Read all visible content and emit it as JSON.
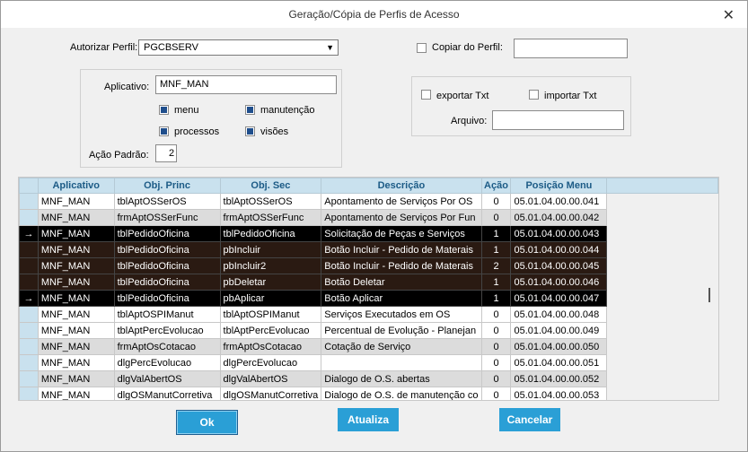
{
  "window": {
    "title": "Geração/Cópia de Perfis de Acesso"
  },
  "form": {
    "autorizar_label": "Autorizar Perfil:",
    "autorizar_value": "PGCBSERV",
    "copiar_label": "Copiar do Perfil:",
    "copiar_value": "",
    "aplicativo_label": "Aplicativo:",
    "aplicativo_value": "MNF_MAN",
    "menu_label": "menu",
    "manutencao_label": "manutenção",
    "processos_label": "processos",
    "visoes_label": "visões",
    "acao_label": "Ação Padrão:",
    "acao_value": "2",
    "exportar_label": "exportar Txt",
    "importar_label": "importar Txt",
    "arquivo_label": "Arquivo:",
    "arquivo_value": ""
  },
  "grid": {
    "columns": [
      "Aplicativo",
      "Obj. Princ",
      "Obj. Sec",
      "Descrição",
      "Ação",
      "Posição Menu"
    ],
    "rows": [
      {
        "style": "norm",
        "arrow": "",
        "cells": [
          "MNF_MAN",
          "tblAptOSSerOS",
          "tblAptOSSerOS",
          "Apontamento de Serviços Por OS",
          "0",
          "05.01.04.00.00.041"
        ]
      },
      {
        "style": "alt",
        "arrow": "",
        "cells": [
          "MNF_MAN",
          "frmAptOSSerFunc",
          "frmAptOSSerFunc",
          "Apontamento de Serviços Por Fun",
          "0",
          "05.01.04.00.00.042"
        ]
      },
      {
        "style": "sel",
        "arrow": "→",
        "cells": [
          "MNF_MAN",
          "tblPedidoOficina",
          "tblPedidoOficina",
          "Solicitação de Peças e Serviços",
          "1",
          "05.01.04.00.00.043"
        ]
      },
      {
        "style": "hl",
        "arrow": "",
        "cells": [
          "MNF_MAN",
          "tblPedidoOficina",
          "pbIncluir",
          "Botão Incluir - Pedido de Materais",
          "1",
          "05.01.04.00.00.044"
        ]
      },
      {
        "style": "hl",
        "arrow": "",
        "cells": [
          "MNF_MAN",
          "tblPedidoOficina",
          "pbIncluir2",
          "Botão Incluir - Pedido de Materais",
          "2",
          "05.01.04.00.00.045"
        ]
      },
      {
        "style": "hl",
        "arrow": "",
        "cells": [
          "MNF_MAN",
          "tblPedidoOficina",
          "pbDeletar",
          "Botão Deletar",
          "1",
          "05.01.04.00.00.046"
        ]
      },
      {
        "style": "sel",
        "arrow": "→",
        "cells": [
          "MNF_MAN",
          "tblPedidoOficina",
          "pbAplicar",
          "Botão Aplicar",
          "1",
          "05.01.04.00.00.047"
        ]
      },
      {
        "style": "norm",
        "arrow": "",
        "cells": [
          "MNF_MAN",
          "tblAptOSPIManut",
          "tblAptOSPIManut",
          "Serviços Executados em OS",
          "0",
          "05.01.04.00.00.048"
        ]
      },
      {
        "style": "norm",
        "arrow": "",
        "cells": [
          "MNF_MAN",
          "tblAptPercEvolucao",
          "tblAptPercEvolucao",
          "Percentual de Evolução - Planejan",
          "0",
          "05.01.04.00.00.049"
        ]
      },
      {
        "style": "alt",
        "arrow": "",
        "cells": [
          "MNF_MAN",
          "frmAptOsCotacao",
          "frmAptOsCotacao",
          "Cotação de Serviço",
          "0",
          "05.01.04.00.00.050"
        ]
      },
      {
        "style": "norm",
        "arrow": "",
        "cells": [
          "MNF_MAN",
          "dlgPercEvolucao",
          "dlgPercEvolucao",
          "",
          "0",
          "05.01.04.00.00.051"
        ]
      },
      {
        "style": "alt",
        "arrow": "",
        "cells": [
          "MNF_MAN",
          "dlgValAbertOS",
          "dlgValAbertOS",
          "Dialogo de O.S. abertas",
          "0",
          "05.01.04.00.00.052"
        ]
      },
      {
        "style": "norm",
        "arrow": "",
        "cells": [
          "MNF_MAN",
          "dlgOSManutCorretiva",
          "dlgOSManutCorretiva",
          "Dialogo de O.S. de manutenção co",
          "0",
          "05.01.04.00.00.053"
        ]
      }
    ]
  },
  "buttons": {
    "ok": "Ok",
    "atualiza": "Atualiza",
    "cancelar": "Cancelar"
  }
}
